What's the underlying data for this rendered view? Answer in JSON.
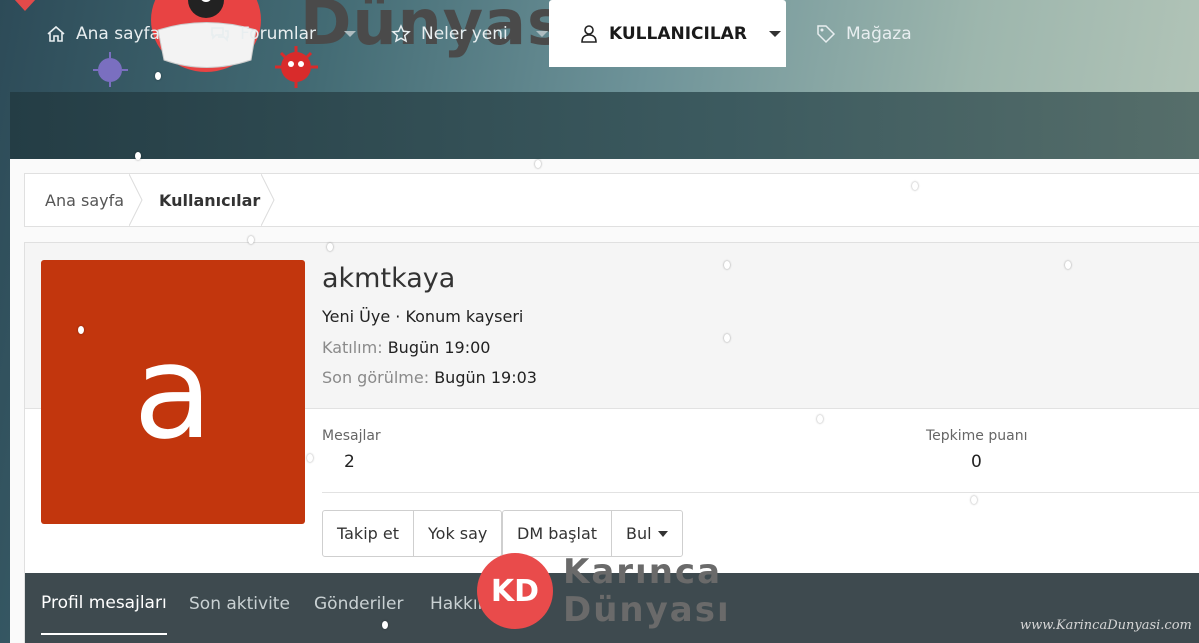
{
  "header": {
    "logo_text": "Dünyası",
    "logo_accent": "ı"
  },
  "nav": {
    "items": [
      {
        "label": "Ana sayfa",
        "icon": "home-icon"
      },
      {
        "label": "Forumlar",
        "icon": "comments-icon"
      },
      {
        "label": "Neler yeni",
        "icon": "star-icon"
      },
      {
        "label": "KULLANICILAR",
        "icon": "user-icon",
        "active": true
      },
      {
        "label": "Mağaza",
        "icon": "tag-icon"
      }
    ]
  },
  "breadcrumb": {
    "items": [
      "Ana sayfa",
      "Kullanıcılar"
    ]
  },
  "profile": {
    "avatar_letter": "a",
    "avatar_color": "#c2360d",
    "username": "akmtkaya",
    "title_line": "Yeni Üye · Konum kayseri",
    "joined_label": "Katılım:",
    "joined_value": "Bugün 19:00",
    "last_seen_label": "Son görülme:",
    "last_seen_value": "Bugün 19:03",
    "stats": {
      "messages_label": "Mesajlar",
      "messages_value": "2",
      "reaction_label": "Tepkime puanı",
      "reaction_value": "0"
    },
    "buttons": {
      "follow": "Takip et",
      "ignore": "Yok say",
      "dm": "DM başlat",
      "find": "Bul"
    }
  },
  "tabs": {
    "items": [
      "Profil mesajları",
      "Son aktivite",
      "Gönderiler",
      "Hakkında"
    ]
  },
  "watermark": {
    "badge": "KD",
    "line1": "Karınca",
    "line2": "Dünyası",
    "url": "www.KarincaDunyasi.com"
  },
  "colors": {
    "accent_red": "#e94b4b",
    "nav_bg": "#2f4d55",
    "tab_bg": "#3e4a4f"
  }
}
